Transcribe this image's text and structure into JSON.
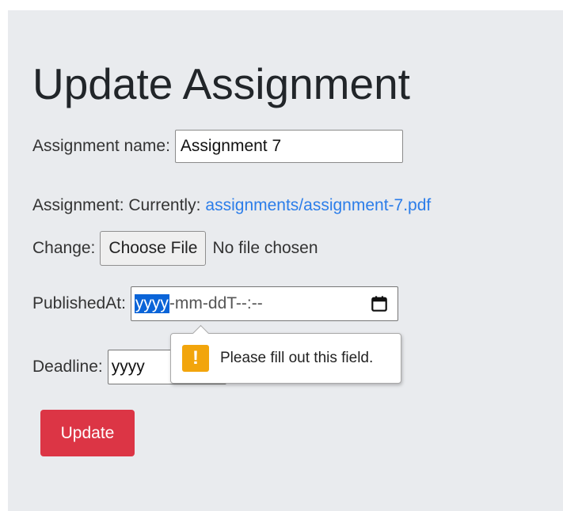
{
  "page": {
    "title": "Update Assignment"
  },
  "form": {
    "name_label": "Assignment name:",
    "name_value": "Assignment 7",
    "assignment_label": "Assignment: Currently:",
    "assignment_link": "assignments/assignment-7.pdf",
    "change_label": "Change:",
    "choose_file_label": "Choose File",
    "no_file_text": "No file chosen",
    "published_label": "PublishedAt:",
    "published_year_segment": "yyyy",
    "published_rest": "-mm-ddT--:--",
    "deadline_label": "Deadline:",
    "deadline_value": "yyyy",
    "submit_label": "Update"
  },
  "validation": {
    "message": "Please fill out this field.",
    "icon_glyph": "!"
  },
  "icons": {
    "calendar": "calendar-icon",
    "warning": "warning-icon"
  },
  "colors": {
    "panel_bg": "#e9ebee",
    "link": "#2b7de9",
    "danger": "#dc3545",
    "selection": "#0a64d8",
    "warning": "#f2a50c"
  }
}
